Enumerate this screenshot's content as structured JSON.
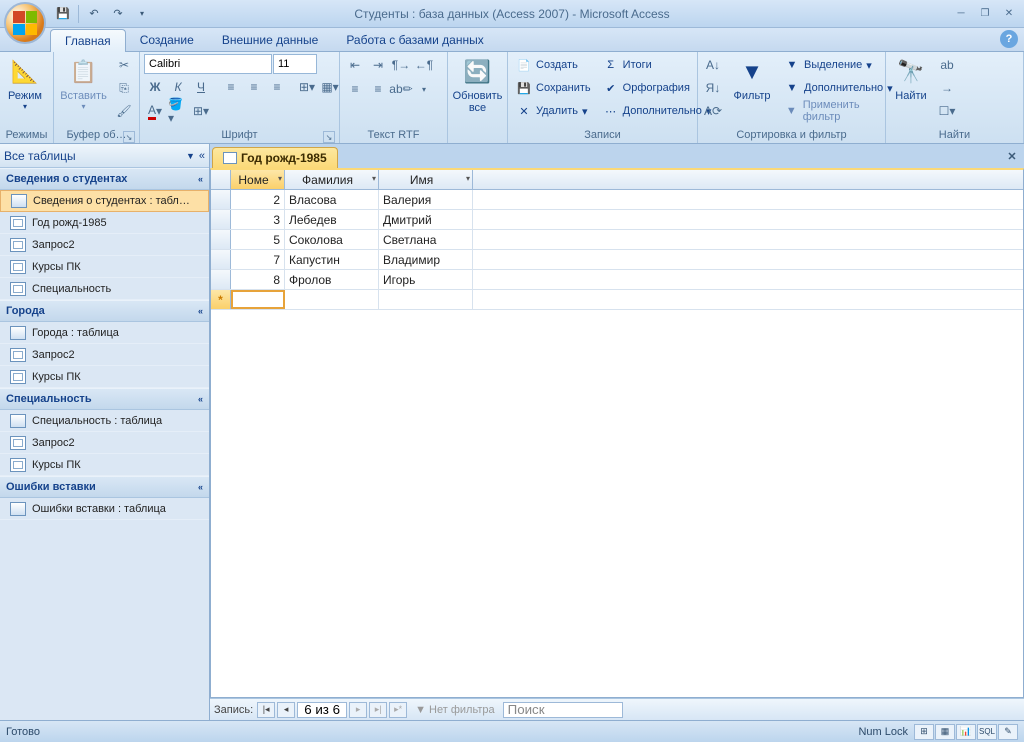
{
  "title": "Студенты : база данных (Access 2007) - Microsoft Access",
  "tabs": {
    "home": "Главная",
    "create": "Создание",
    "external": "Внешние данные",
    "dbtools": "Работа с базами данных"
  },
  "ribbon": {
    "mode_group": "Режимы",
    "mode": "Режим",
    "clipboard_group": "Буфер об…",
    "paste": "Вставить",
    "font_group": "Шрифт",
    "font_name": "Calibri",
    "font_size": "11",
    "rtf_group": "Текст RTF",
    "refresh": "Обновить\nвсе",
    "records_group": "Записи",
    "new": "Создать",
    "save": "Сохранить",
    "delete": "Удалить",
    "totals": "Итоги",
    "spelling": "Орфография",
    "more": "Дополнительно",
    "sortfilter_group": "Сортировка и фильтр",
    "filter": "Фильтр",
    "selection": "Выделение",
    "advanced": "Дополнительно",
    "togglefilter": "Применить фильтр",
    "find_group": "Найти",
    "find": "Найти"
  },
  "nav": {
    "header": "Все таблицы",
    "groups": [
      {
        "title": "Сведения о студентах",
        "items": [
          {
            "label": "Сведения о студентах : табл…",
            "type": "table",
            "sel": true
          },
          {
            "label": "Год рожд-1985",
            "type": "query"
          },
          {
            "label": "Запрос2",
            "type": "query"
          },
          {
            "label": "Курсы ПК",
            "type": "query"
          },
          {
            "label": "Специальность",
            "type": "query"
          }
        ]
      },
      {
        "title": "Города",
        "items": [
          {
            "label": "Города : таблица",
            "type": "table"
          },
          {
            "label": "Запрос2",
            "type": "query"
          },
          {
            "label": "Курсы ПК",
            "type": "query"
          }
        ]
      },
      {
        "title": "Специальность",
        "items": [
          {
            "label": "Специальность : таблица",
            "type": "table"
          },
          {
            "label": "Запрос2",
            "type": "query"
          },
          {
            "label": "Курсы ПК",
            "type": "query"
          }
        ]
      },
      {
        "title": "Ошибки вставки",
        "items": [
          {
            "label": "Ошибки вставки : таблица",
            "type": "table"
          }
        ]
      }
    ]
  },
  "doc": {
    "tab": "Год рожд-1985",
    "columns": [
      {
        "label": "Номе",
        "w": "w-id",
        "active": true
      },
      {
        "label": "Фамилия",
        "w": "w-fam"
      },
      {
        "label": "Имя",
        "w": "w-name"
      }
    ],
    "rows": [
      {
        "id": "2",
        "fam": "Власова",
        "name": "Валерия"
      },
      {
        "id": "3",
        "fam": "Лебедев",
        "name": "Дмитрий"
      },
      {
        "id": "5",
        "fam": "Соколова",
        "name": "Светлана"
      },
      {
        "id": "7",
        "fam": "Капустин",
        "name": "Владимир"
      },
      {
        "id": "8",
        "fam": "Фролов",
        "name": "Игорь"
      }
    ]
  },
  "recnav": {
    "label": "Запись:",
    "pos": "6 из 6",
    "nofilter": "Нет фильтра",
    "search": "Поиск"
  },
  "status": {
    "ready": "Готово",
    "numlock": "Num Lock"
  }
}
